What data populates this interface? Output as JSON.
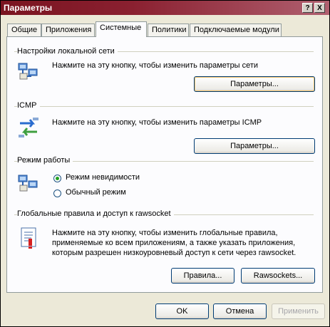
{
  "window": {
    "title": "Параметры",
    "help_label": "?",
    "close_label": "X"
  },
  "tabs": [
    {
      "label": "Общие",
      "active": false
    },
    {
      "label": "Приложения",
      "active": false
    },
    {
      "label": "Системные",
      "active": true
    },
    {
      "label": "Политики",
      "active": false
    },
    {
      "label": "Подключаемые модули",
      "active": false
    }
  ],
  "lan": {
    "heading": "Настройки локальной сети",
    "description": "Нажмите на эту кнопку, чтобы изменить параметры сети",
    "button_label": "Параметры...",
    "icon": "network-computers-icon"
  },
  "icmp": {
    "heading": "ICMP",
    "description": "Нажмите на эту кнопку, чтобы изменить параметры ICMP",
    "button_label": "Параметры...",
    "icon": "exchange-arrows-icon"
  },
  "mode": {
    "heading": "Режим работы",
    "options": [
      {
        "label": "Режим невидимости",
        "selected": true
      },
      {
        "label": "Обычный режим",
        "selected": false
      }
    ],
    "icon": "stealth-network-icon"
  },
  "global": {
    "heading": "Глобальные правила и доступ к rawsocket",
    "description_lines": [
      "Нажмите на эту кнопку, чтобы изменить глобальные правила,",
      "применяемые ко всем приложениям, а также указать приложения,",
      "которым разрешен низкоуровневый доступ к сети через rawsocket."
    ],
    "rules_button": "Правила...",
    "rawsockets_button": "Rawsockets...",
    "icon": "rules-document-icon"
  },
  "footer": {
    "ok": "OK",
    "cancel": "Отмена",
    "apply": "Применить"
  }
}
